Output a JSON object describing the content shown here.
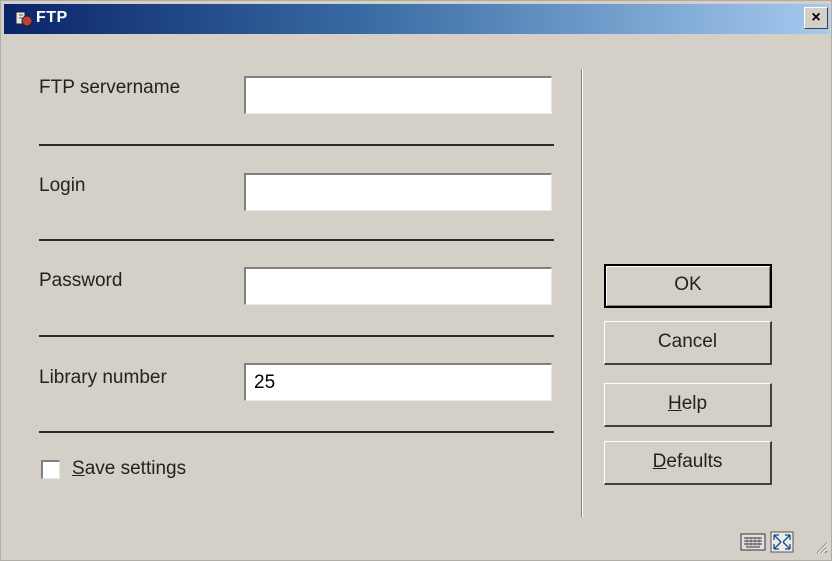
{
  "window": {
    "title": "FTP",
    "close_glyph": "×"
  },
  "form": {
    "fields": [
      {
        "label": "FTP servername",
        "value": "",
        "placeholder": ""
      },
      {
        "label": "Login",
        "value": "",
        "placeholder": ""
      },
      {
        "label": "Password",
        "value": "",
        "placeholder": ""
      },
      {
        "label": "Library number",
        "value": "25",
        "placeholder": ""
      }
    ],
    "checkbox": {
      "label_mnemonic": "S",
      "label_rest": "ave settings",
      "checked": false
    }
  },
  "buttons": {
    "ok": {
      "label": "OK"
    },
    "cancel": {
      "label": "Cancel"
    },
    "help": {
      "mnemonic": "H",
      "rest": "elp"
    },
    "defaults": {
      "mnemonic": "D",
      "rest": "efaults"
    }
  },
  "icons": {
    "title": "ftp-app-icon",
    "close": "close-icon",
    "keyboard": "keyboard-icon",
    "resize": "resize-icon",
    "grip": "size-grip-icon"
  }
}
